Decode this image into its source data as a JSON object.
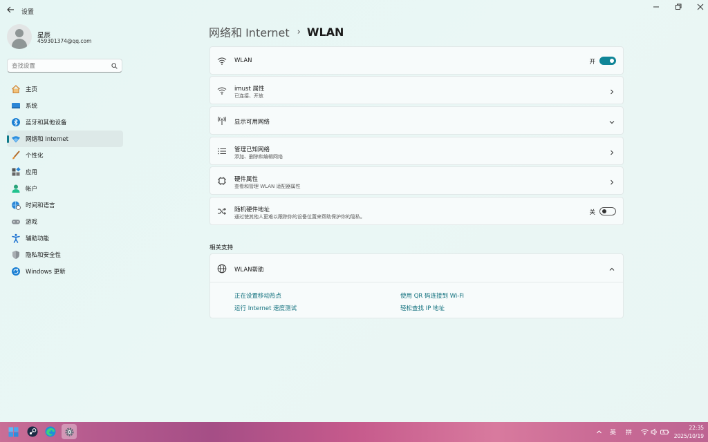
{
  "window": {
    "title": "设置"
  },
  "profile": {
    "name": "星辰",
    "email": "459301374@qq.com"
  },
  "search": {
    "placeholder": "查找设置"
  },
  "sidebar": {
    "items": [
      {
        "label": "主页",
        "icon": "home-icon"
      },
      {
        "label": "系统",
        "icon": "system-icon"
      },
      {
        "label": "蓝牙和其他设备",
        "icon": "bluetooth-icon"
      },
      {
        "label": "网络和 Internet",
        "icon": "network-icon",
        "active": true
      },
      {
        "label": "个性化",
        "icon": "brush-icon"
      },
      {
        "label": "应用",
        "icon": "apps-icon"
      },
      {
        "label": "帐户",
        "icon": "account-icon"
      },
      {
        "label": "时间和语言",
        "icon": "globe-clock-icon"
      },
      {
        "label": "游戏",
        "icon": "gamepad-icon"
      },
      {
        "label": "辅助功能",
        "icon": "accessibility-icon"
      },
      {
        "label": "隐私和安全性",
        "icon": "shield-icon"
      },
      {
        "label": "Windows 更新",
        "icon": "update-icon"
      }
    ]
  },
  "breadcrumb": {
    "parent": "网络和 Internet",
    "separator": "›",
    "current": "WLAN"
  },
  "cards": {
    "wlan": {
      "title": "WLAN",
      "toggle_label": "开",
      "toggle_on": true
    },
    "imust": {
      "title": "imust 属性",
      "subtitle": "已连接、开放"
    },
    "available": {
      "title": "显示可用网络"
    },
    "known": {
      "title": "管理已知网络",
      "subtitle": "添加、删除和编辑网络"
    },
    "hardware": {
      "title": "硬件属性",
      "subtitle": "查看和管理 WLAN 适配器属性"
    },
    "random": {
      "title": "随机硬件地址",
      "subtitle": "通过使其他人更难以跟踪你的设备位置来帮助保护你的隐私。",
      "toggle_label": "关",
      "toggle_on": false
    }
  },
  "related": {
    "title": "相关支持",
    "help_title": "WLAN帮助",
    "links": [
      "正在设置移动热点",
      "使用 QR 码连接到 Wi-Fi",
      "运行 Internet 速度测试",
      "轻松查找 IP 地址"
    ]
  },
  "taskbar": {
    "apps": [
      "windows-start-icon",
      "steam-icon",
      "edge-icon",
      "settings-icon"
    ],
    "tray": {
      "lang1": "英",
      "lang2": "拼"
    },
    "time": "22:35",
    "date": "2025/10/19"
  },
  "colors": {
    "accent": "#0f8597",
    "link": "#0f6f7c",
    "background": "#e6f6f4"
  }
}
